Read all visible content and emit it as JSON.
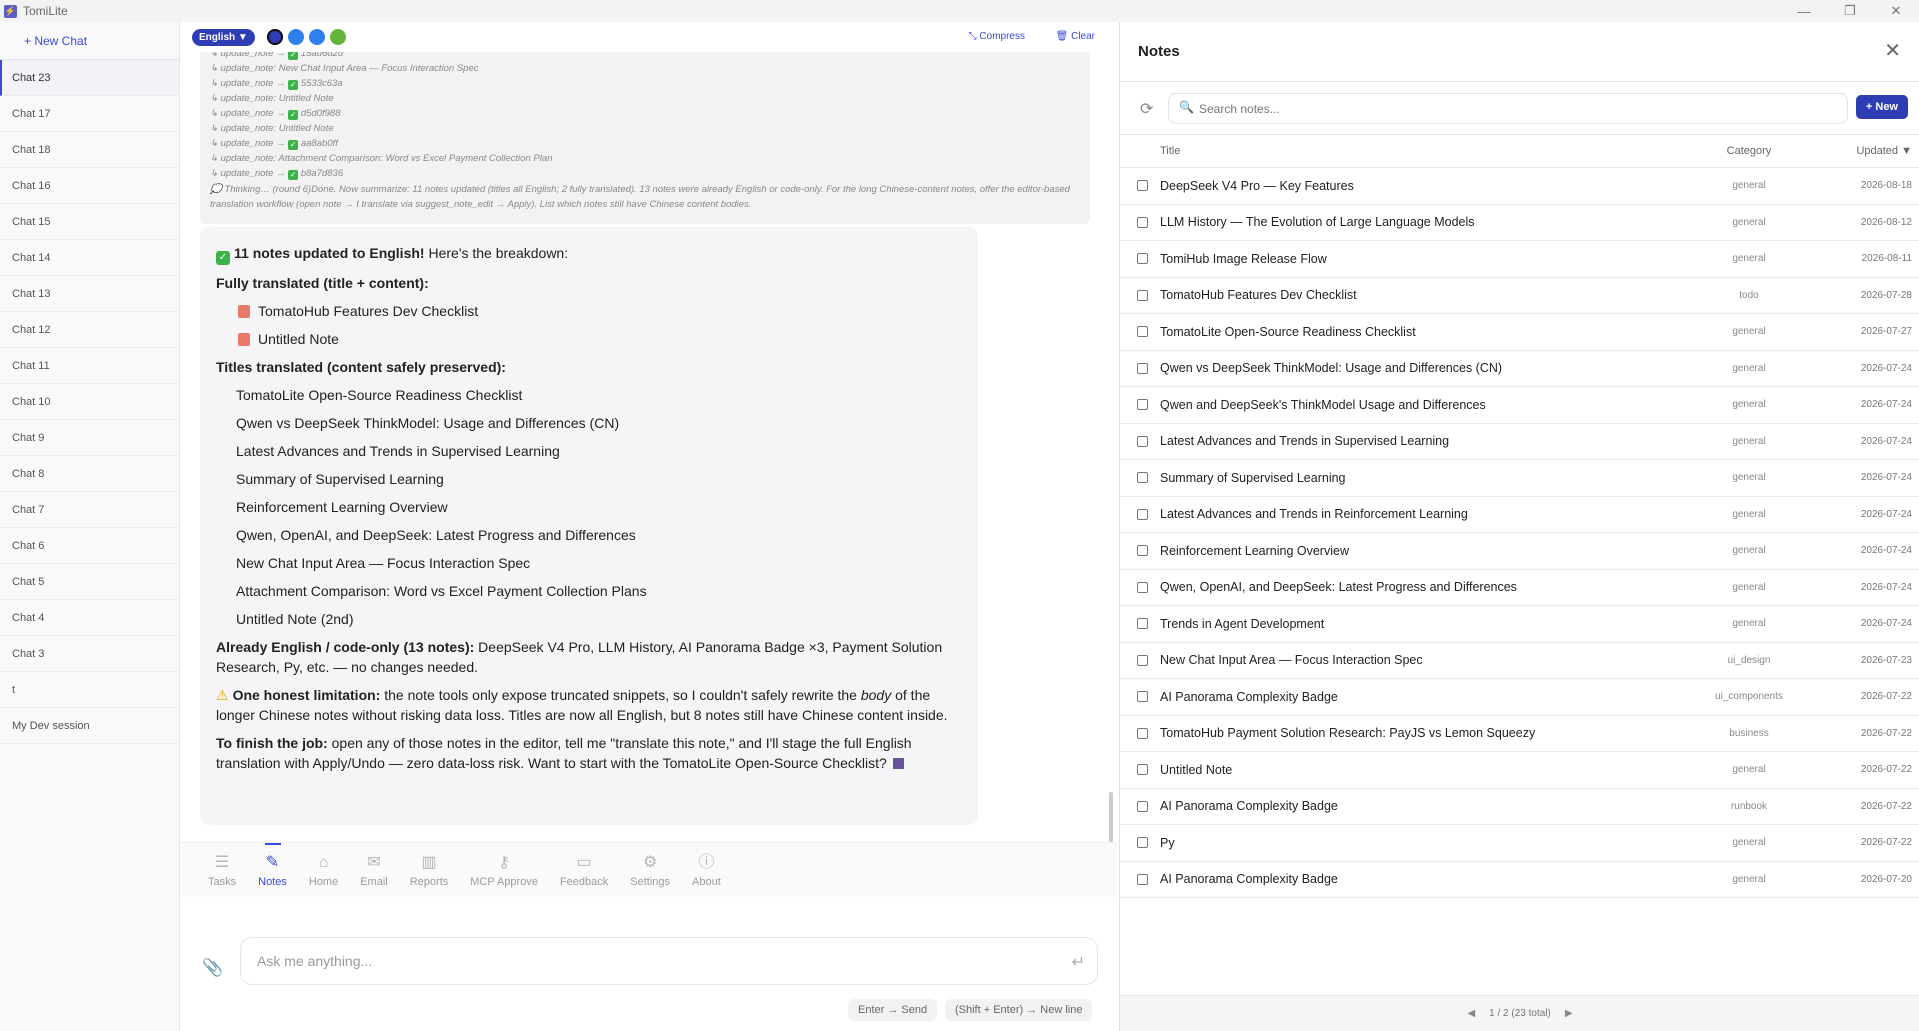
{
  "app": {
    "title": "TomiLite",
    "logo_glyph": "⚡",
    "minimize": "—",
    "maximize": "❐",
    "close": "✕"
  },
  "sidebar": {
    "new_chat": "+ New Chat",
    "chats": [
      "Chat 23",
      "Chat 17",
      "Chat 18",
      "Chat 16",
      "Chat 15",
      "Chat 14",
      "Chat 13",
      "Chat 12",
      "Chat 11",
      "Chat 10",
      "Chat 9",
      "Chat 8",
      "Chat 7",
      "Chat 6",
      "Chat 5",
      "Chat 4",
      "Chat 3",
      "t",
      "My Dev session"
    ],
    "active_index": 0
  },
  "chat": {
    "language": "English ▼",
    "compress": "⤡ Compress",
    "clear": "🗑 Clear",
    "colors": {
      "accent": "#2f3db4",
      "blue": "#2f80ed",
      "green": "#63b43a"
    },
    "tool_log": [
      {
        "text": "↳ update_note → ",
        "id": "15ad6d2d"
      },
      {
        "text": "↳ update_note: New Chat Input Area — Focus Interaction Spec",
        "id": ""
      },
      {
        "text": "↳ update_note → ",
        "id": "5533c63a"
      },
      {
        "text": "↳ update_note: Untitled Note",
        "id": ""
      },
      {
        "text": "↳ update_note → ",
        "id": "d5d0f988"
      },
      {
        "text": "↳ update_note: Untitled Note",
        "id": ""
      },
      {
        "text": "↳ update_note → ",
        "id": "aa8ab0ff"
      },
      {
        "text": "↳ update_note: Attachment Comparison: Word vs Excel Payment Collection Plan",
        "id": ""
      },
      {
        "text": "↳ update_note → ",
        "id": "b8a7d836"
      }
    ],
    "thinking": "💭 Thinking… (round 6)Done. Now summarize: 11 notes updated (titles all English; 2 fully translated). 13 notes were already English or code-only. For the long Chinese-content notes, offer the editor-based translation workflow (open note → I translate via suggest_note_edit → Apply). List which notes still have Chinese content bodies.",
    "message": {
      "headline_bold": "11 notes updated to English!",
      "headline_rest": " Here's the breakdown:",
      "fully_translated_label": "Fully translated (title + content):",
      "fully_translated": [
        "TomatoHub Features Dev Checklist",
        "Untitled Note"
      ],
      "titles_label": "Titles translated (content safely preserved):",
      "titles": [
        "TomatoLite Open-Source Readiness Checklist",
        "Qwen vs DeepSeek ThinkModel: Usage and Differences (CN)",
        "Latest Advances and Trends in Supervised Learning",
        "Summary of Supervised Learning",
        "Reinforcement Learning Overview",
        "Qwen, OpenAI, and DeepSeek: Latest Progress and Differences",
        "New Chat Input Area — Focus Interaction Spec",
        "Attachment Comparison: Word vs Excel Payment Collection Plans",
        "Untitled Note (2nd)"
      ],
      "already_bold": "Already English / code-only (13 notes):",
      "already_rest": " DeepSeek V4 Pro, LLM History, AI Panorama Badge ×3, Payment Solution Research, Py, etc. — no changes needed.",
      "limit_bold": "One honest limitation:",
      "limit_a": " the note tools only expose truncated snippets, so I couldn't safely rewrite the ",
      "limit_em": "body",
      "limit_b": " of the longer Chinese notes without risking data loss. Titles are now all English, but 8 notes still have Chinese content inside.",
      "finish_bold": "To finish the job:",
      "finish_rest": " open any of those notes in the editor, tell me \"translate this note,\" and I'll stage the full English translation with Apply/Undo — zero data-loss risk. Want to start with the TomatoLite Open-Source Checklist?"
    },
    "tabs": [
      {
        "label": "Tasks",
        "icon": "☰"
      },
      {
        "label": "Notes",
        "icon": "✎"
      },
      {
        "label": "Home",
        "icon": "⌂"
      },
      {
        "label": "Email",
        "icon": "✉"
      },
      {
        "label": "Reports",
        "icon": "▥"
      },
      {
        "label": "MCP Approve",
        "icon": "⚷"
      },
      {
        "label": "Feedback",
        "icon": "▭"
      },
      {
        "label": "Settings",
        "icon": "⚙"
      },
      {
        "label": "About",
        "icon": "ⓘ"
      }
    ],
    "active_tab": "Notes",
    "input_placeholder": "Ask me anything...",
    "attach_icon": "📎",
    "send_icon": "↵",
    "hint_send": "Enter → Send",
    "hint_newline": "(Shift + Enter) → New line"
  },
  "notes": {
    "title": "Notes",
    "close": "✕",
    "refresh": "⟳",
    "search_icon": "🔍",
    "search_placeholder": "Search notes...",
    "new_button": "+ New",
    "columns": {
      "title": "Title",
      "category": "Category",
      "updated": "Updated ▼"
    },
    "rows": [
      {
        "title": "DeepSeek V4 Pro — Key Features",
        "category": "general",
        "updated": "2026-08-18"
      },
      {
        "title": "LLM History — The Evolution of Large Language Models",
        "category": "general",
        "updated": "2026-08-12"
      },
      {
        "title": "TomiHub Image Release Flow",
        "category": "general",
        "updated": "2026-08-11"
      },
      {
        "title": "TomatoHub Features Dev Checklist",
        "category": "todo",
        "updated": "2026-07-28"
      },
      {
        "title": "TomatoLite Open-Source Readiness Checklist",
        "category": "general",
        "updated": "2026-07-27"
      },
      {
        "title": "Qwen vs DeepSeek ThinkModel: Usage and Differences (CN)",
        "category": "general",
        "updated": "2026-07-24"
      },
      {
        "title": "Qwen and DeepSeek's ThinkModel Usage and Differences",
        "category": "general",
        "updated": "2026-07-24"
      },
      {
        "title": "Latest Advances and Trends in Supervised Learning",
        "category": "general",
        "updated": "2026-07-24"
      },
      {
        "title": "Summary of Supervised Learning",
        "category": "general",
        "updated": "2026-07-24"
      },
      {
        "title": "Latest Advances and Trends in Reinforcement Learning",
        "category": "general",
        "updated": "2026-07-24"
      },
      {
        "title": "Reinforcement Learning Overview",
        "category": "general",
        "updated": "2026-07-24"
      },
      {
        "title": "Qwen, OpenAI, and DeepSeek: Latest Progress and Differences",
        "category": "general",
        "updated": "2026-07-24"
      },
      {
        "title": "Trends in Agent Development",
        "category": "general",
        "updated": "2026-07-24"
      },
      {
        "title": "New Chat Input Area — Focus Interaction Spec",
        "category": "ui_design",
        "updated": "2026-07-23"
      },
      {
        "title": "AI Panorama Complexity Badge",
        "category": "ui_components",
        "updated": "2026-07-22"
      },
      {
        "title": "TomatoHub Payment Solution Research: PayJS vs Lemon Squeezy",
        "category": "business",
        "updated": "2026-07-22"
      },
      {
        "title": "Untitled Note",
        "category": "general",
        "updated": "2026-07-22"
      },
      {
        "title": "AI Panorama Complexity Badge",
        "category": "runbook",
        "updated": "2026-07-22"
      },
      {
        "title": "Py",
        "category": "general",
        "updated": "2026-07-22"
      },
      {
        "title": "AI Panorama Complexity Badge",
        "category": "general",
        "updated": "2026-07-20"
      }
    ],
    "pagination": {
      "prev": "◀",
      "label": "1 / 2 (23 total)",
      "next": "▶"
    }
  }
}
